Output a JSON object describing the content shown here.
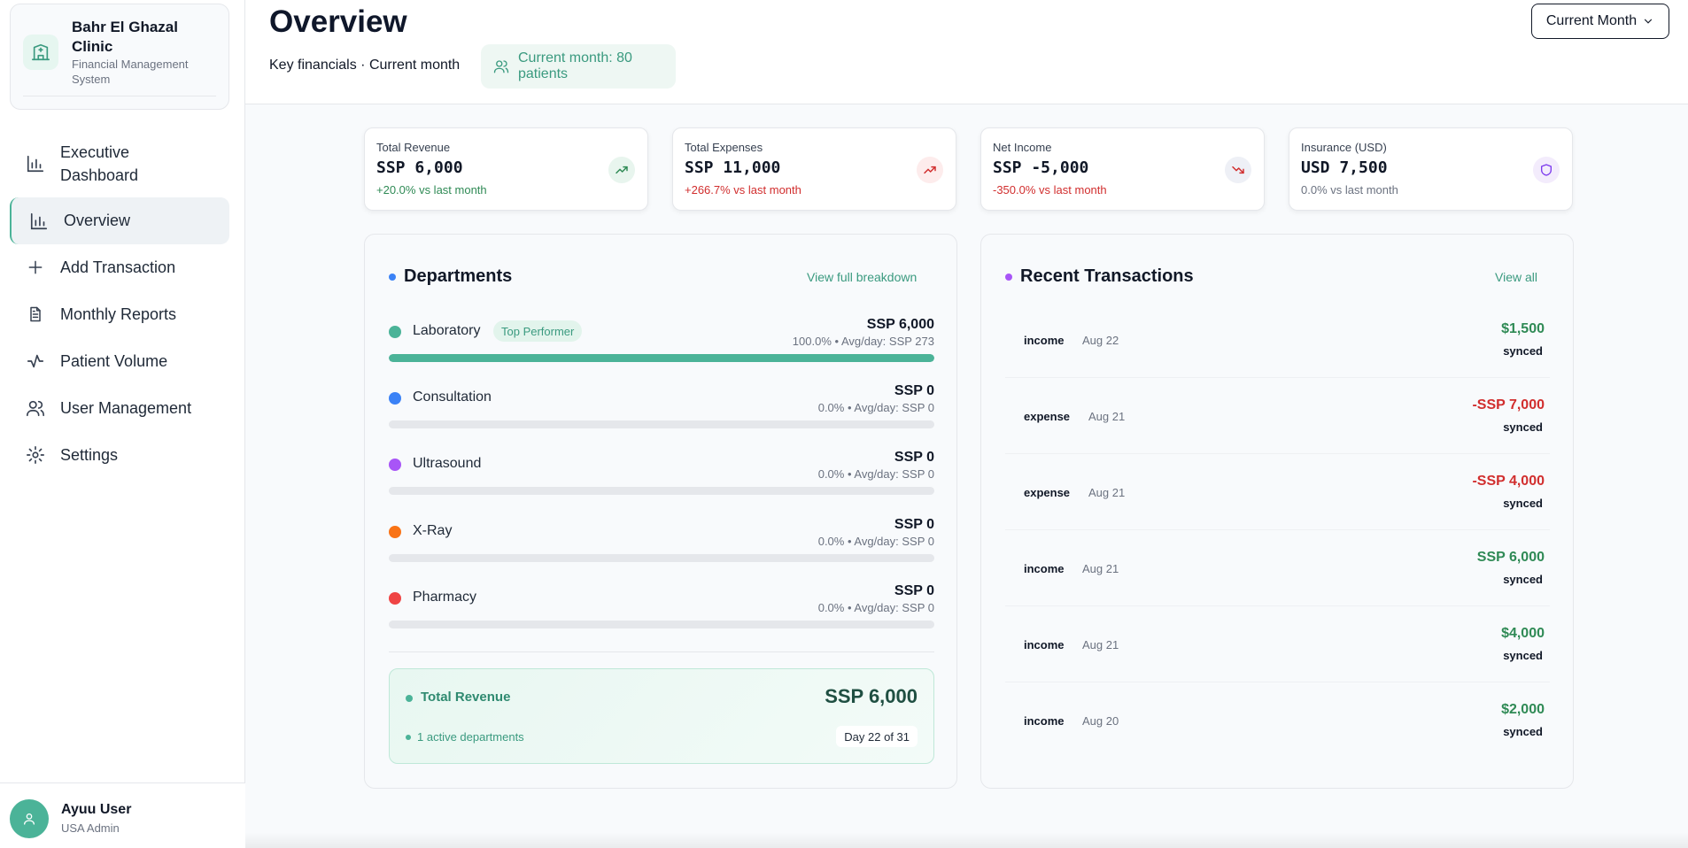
{
  "brand": {
    "name": "Bahr El Ghazal Clinic",
    "subtitle": "Financial Management System",
    "icon": "hospital-building-icon"
  },
  "nav": [
    {
      "label": "Executive Dashboard",
      "icon": "bar-chart-icon",
      "active": false
    },
    {
      "label": "Overview",
      "icon": "bar-chart-icon",
      "active": true
    },
    {
      "label": "Add Transaction",
      "icon": "plus-icon",
      "active": false
    },
    {
      "label": "Monthly Reports",
      "icon": "document-icon",
      "active": false
    },
    {
      "label": "Patient Volume",
      "icon": "activity-icon",
      "active": false
    },
    {
      "label": "User Management",
      "icon": "users-icon",
      "active": false
    },
    {
      "label": "Settings",
      "icon": "gear-icon",
      "active": false
    }
  ],
  "user": {
    "name": "Ayuu User",
    "role": "USA Admin"
  },
  "header": {
    "title": "Overview",
    "subtitle": "Key financials · Current month",
    "patients_pill": "Current month: 80 patients",
    "period_select": "Current Month"
  },
  "kpis": [
    {
      "label": "Total Revenue",
      "value": "SSP 6,000",
      "change": "+20.0% vs last month",
      "tone": "positive",
      "icon": "trending-up-icon",
      "color": "#2f8a55"
    },
    {
      "label": "Total Expenses",
      "value": "SSP 11,000",
      "change": "+266.7% vs last month",
      "tone": "negative",
      "icon": "trending-up-icon",
      "color": "#d12e2e"
    },
    {
      "label": "Net Income",
      "value": "SSP -5,000",
      "change": "-350.0% vs last month",
      "tone": "negative",
      "icon": "trending-down-icon",
      "color": "#d12e2e"
    },
    {
      "label": "Insurance (USD)",
      "value": "USD 7,500",
      "change": "0.0% vs last month",
      "tone": "neutral",
      "icon": "shield-icon",
      "color": "#6b7280"
    }
  ],
  "departments": {
    "title": "Departments",
    "link": "View full breakdown",
    "items": [
      {
        "name": "Laboratory",
        "badge": "Top Performer",
        "amount": "SSP 6,000",
        "meta": "100.0% • Avg/day: SSP 273",
        "share": 100,
        "color": "#4bb398"
      },
      {
        "name": "Consultation",
        "badge": "",
        "amount": "SSP 0",
        "meta": "0.0% • Avg/day: SSP 0",
        "share": 0,
        "color": "#3b82f6"
      },
      {
        "name": "Ultrasound",
        "badge": "",
        "amount": "SSP 0",
        "meta": "0.0% • Avg/day: SSP 0",
        "share": 0,
        "color": "#a855f7"
      },
      {
        "name": "X-Ray",
        "badge": "",
        "amount": "SSP 0",
        "meta": "0.0% • Avg/day: SSP 0",
        "share": 0,
        "color": "#f97316"
      },
      {
        "name": "Pharmacy",
        "badge": "",
        "amount": "SSP 0",
        "meta": "0.0% • Avg/day: SSP 0",
        "share": 0,
        "color": "#ef4444"
      }
    ],
    "total": {
      "label": "Total Revenue",
      "value": "SSP 6,000",
      "active": "1 active departments",
      "day": "Day 22 of 31"
    }
  },
  "transactions": {
    "title": "Recent Transactions",
    "link": "View all",
    "items": [
      {
        "type": "income",
        "date": "Aug 22",
        "amount": "$1,500",
        "status": "synced"
      },
      {
        "type": "expense",
        "date": "Aug 21",
        "amount": "-SSP 7,000",
        "status": "synced"
      },
      {
        "type": "expense",
        "date": "Aug 21",
        "amount": "-SSP 4,000",
        "status": "synced"
      },
      {
        "type": "income",
        "date": "Aug 21",
        "amount": "SSP 6,000",
        "status": "synced"
      },
      {
        "type": "income",
        "date": "Aug 21",
        "amount": "$4,000",
        "status": "synced"
      },
      {
        "type": "income",
        "date": "Aug 20",
        "amount": "$2,000",
        "status": "synced"
      }
    ]
  },
  "colors": {
    "accent": "#4bb398",
    "positive": "#2f8a55",
    "negative": "#d12e2e",
    "departments_dot": "#3b82f6",
    "transactions_dot": "#a855f7"
  }
}
